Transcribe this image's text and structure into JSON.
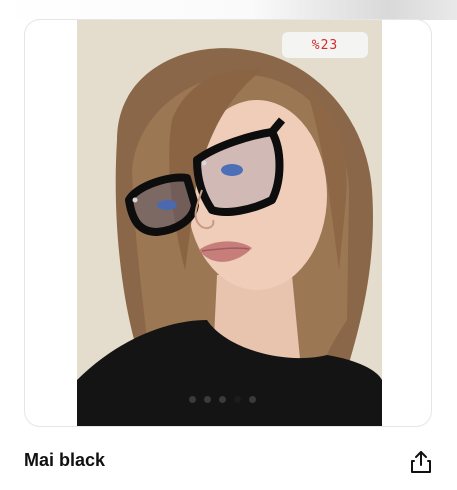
{
  "product": {
    "title": "Mai black",
    "discount_badge": "%23",
    "image": {
      "total_images": 5,
      "active_index": 3
    }
  },
  "actions": {
    "share_icon": "share-icon"
  },
  "colors": {
    "badge_text": "#d22b2b",
    "title_text": "#111111"
  }
}
